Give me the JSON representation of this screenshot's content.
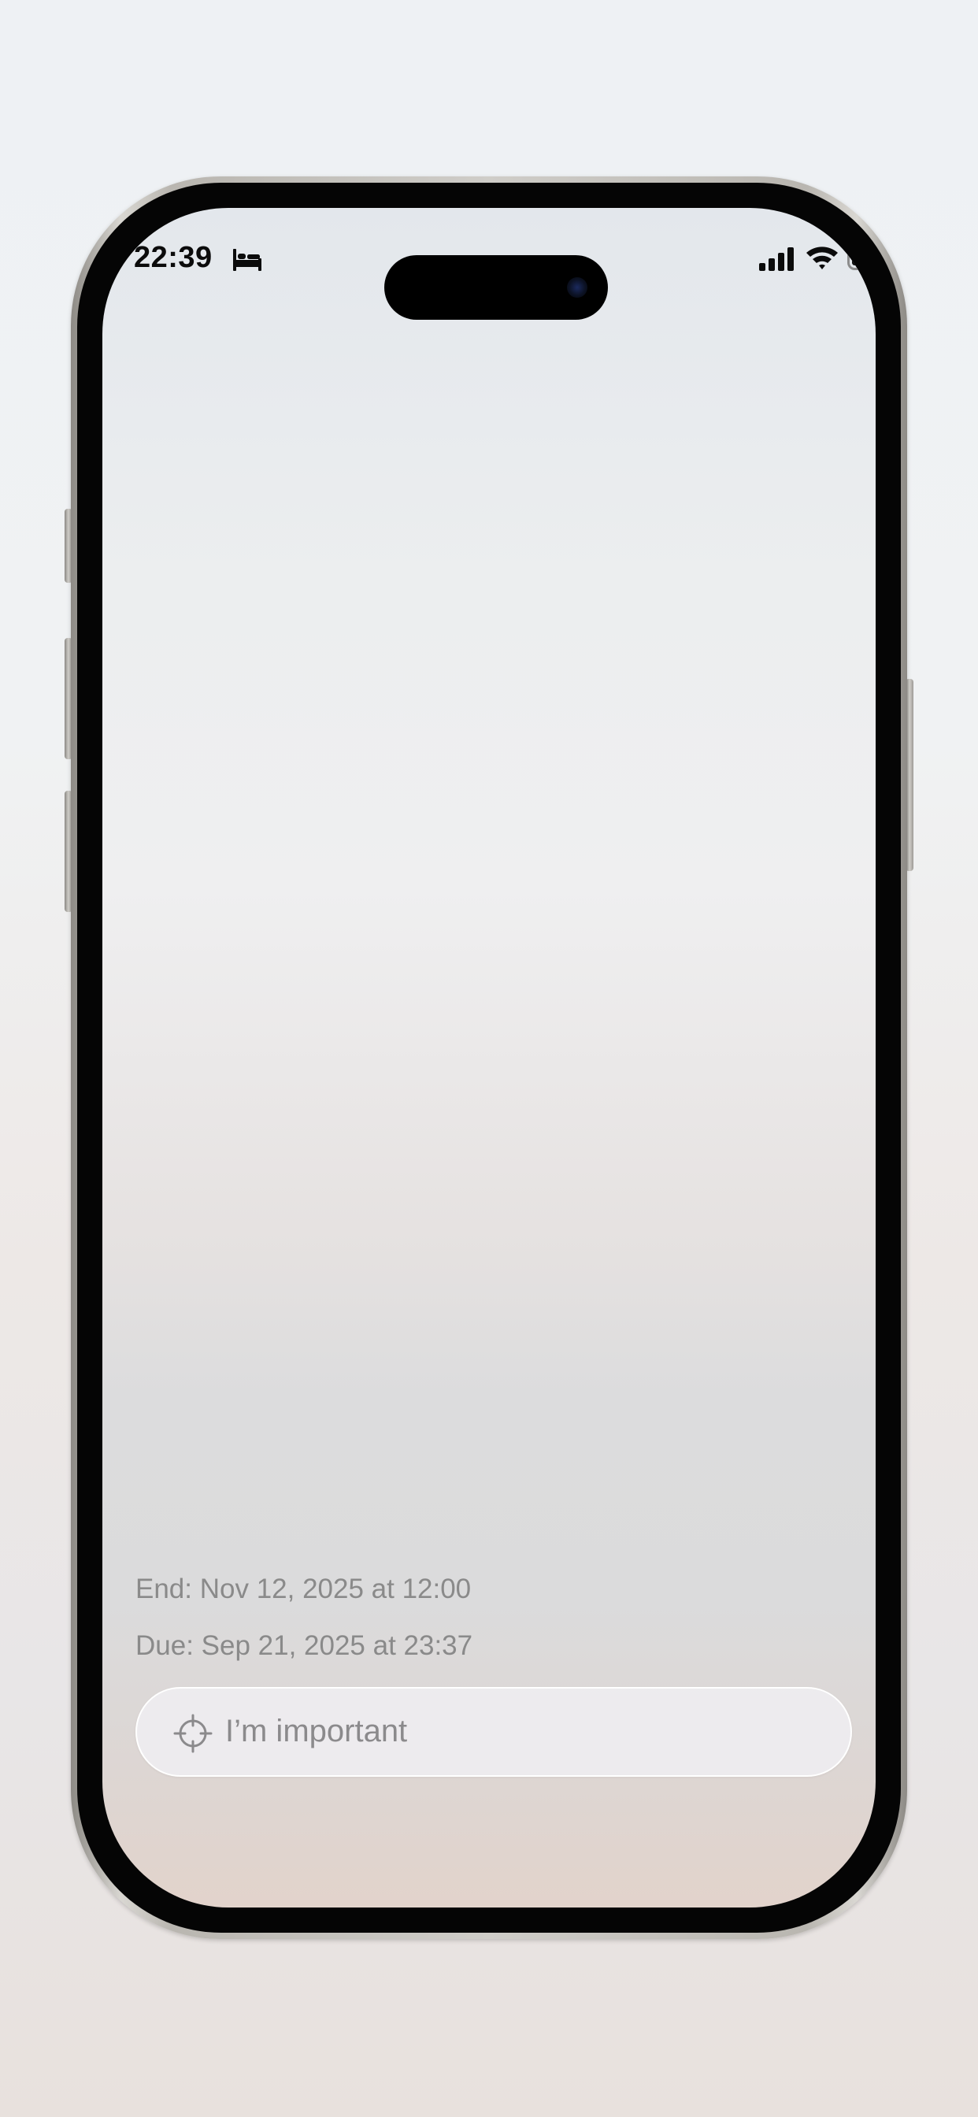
{
  "status_bar": {
    "time": "22:39",
    "icons": [
      "bed-icon",
      "cellular-signal-icon",
      "wifi-icon",
      "battery-icon"
    ]
  },
  "task": {
    "end_text": "End: Nov 12, 2025 at 12:00",
    "due_text": "Due: Sep 21, 2025 at 23:37",
    "title": "I’m important",
    "leading_icon": "crosshair-icon"
  },
  "colors": {
    "meta_text": "#8a8a8a",
    "input_text": "#8b8a8c"
  }
}
